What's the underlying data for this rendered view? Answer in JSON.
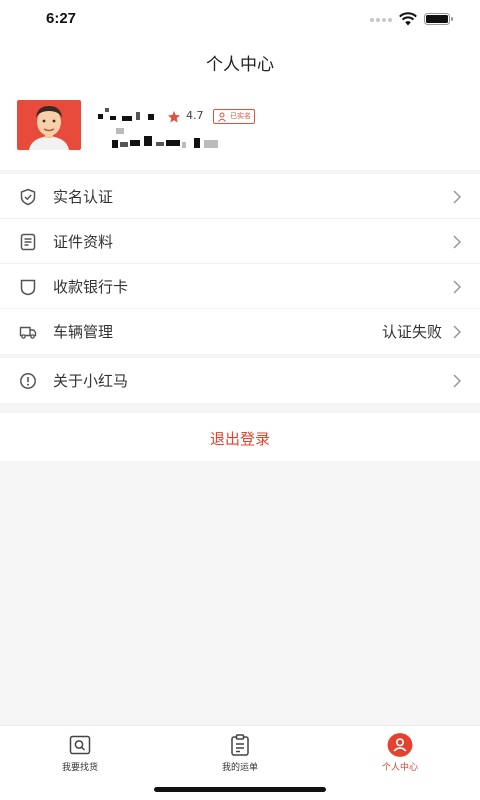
{
  "status_bar": {
    "time": "6:27"
  },
  "header": {
    "title": "个人中心"
  },
  "profile": {
    "rating": "4.7",
    "badge": "已实名"
  },
  "menu": [
    {
      "label": "实名认证",
      "icon": "shield-check-icon",
      "value": ""
    },
    {
      "label": "证件资料",
      "icon": "document-icon",
      "value": ""
    },
    {
      "label": "收款银行卡",
      "icon": "bank-card-icon",
      "value": ""
    },
    {
      "label": "车辆管理",
      "icon": "truck-icon",
      "value": "认证失败"
    }
  ],
  "about": {
    "label": "关于小红马",
    "icon": "info-icon"
  },
  "logout": {
    "label": "退出登录"
  },
  "tabs": [
    {
      "label": "我要找货",
      "icon": "search-goods-icon"
    },
    {
      "label": "我的运单",
      "icon": "clipboard-icon"
    },
    {
      "label": "个人中心",
      "icon": "user-icon"
    }
  ],
  "colors": {
    "accent": "#e5412f",
    "background": "#f5f5f5",
    "avatar_bg": "#e84a3b"
  }
}
